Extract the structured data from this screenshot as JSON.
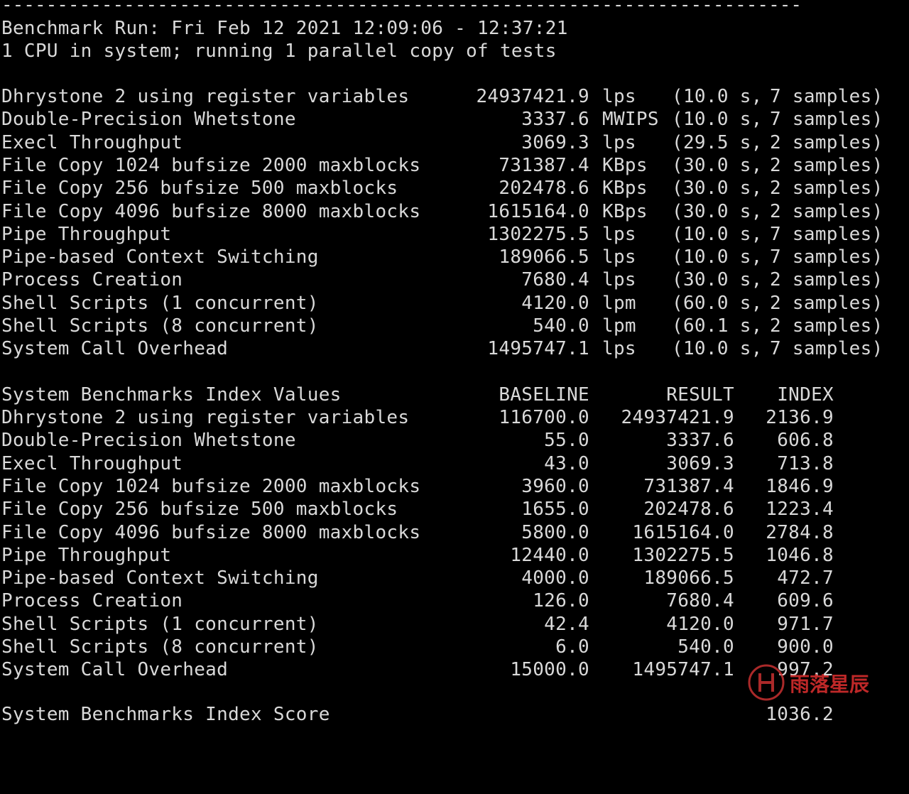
{
  "rule": "------------------------------------------------------------------------",
  "header": {
    "run": "Benchmark Run: Fri Feb 12 2021 12:09:06 - 12:37:21",
    "cpus": "1 CPU in system; running 1 parallel copy of tests"
  },
  "results": [
    {
      "name": "Dhrystone 2 using register variables",
      "value": "24937421.9",
      "unit": "lps",
      "time": "(10.0 s,",
      "samples": "7 samples)"
    },
    {
      "name": "Double-Precision Whetstone",
      "value": "3337.6",
      "unit": "MWIPS",
      "time": "(10.0 s,",
      "samples": "7 samples)"
    },
    {
      "name": "Execl Throughput",
      "value": "3069.3",
      "unit": "lps",
      "time": "(29.5 s,",
      "samples": "2 samples)"
    },
    {
      "name": "File Copy 1024 bufsize 2000 maxblocks",
      "value": "731387.4",
      "unit": "KBps",
      "time": "(30.0 s,",
      "samples": "2 samples)"
    },
    {
      "name": "File Copy 256 bufsize 500 maxblocks",
      "value": "202478.6",
      "unit": "KBps",
      "time": "(30.0 s,",
      "samples": "2 samples)"
    },
    {
      "name": "File Copy 4096 bufsize 8000 maxblocks",
      "value": "1615164.0",
      "unit": "KBps",
      "time": "(30.0 s,",
      "samples": "2 samples)"
    },
    {
      "name": "Pipe Throughput",
      "value": "1302275.5",
      "unit": "lps",
      "time": "(10.0 s,",
      "samples": "7 samples)"
    },
    {
      "name": "Pipe-based Context Switching",
      "value": "189066.5",
      "unit": "lps",
      "time": "(10.0 s,",
      "samples": "7 samples)"
    },
    {
      "name": "Process Creation",
      "value": "7680.4",
      "unit": "lps",
      "time": "(30.0 s,",
      "samples": "2 samples)"
    },
    {
      "name": "Shell Scripts (1 concurrent)",
      "value": "4120.0",
      "unit": "lpm",
      "time": "(60.0 s,",
      "samples": "2 samples)"
    },
    {
      "name": "Shell Scripts (8 concurrent)",
      "value": "540.0",
      "unit": "lpm",
      "time": "(60.1 s,",
      "samples": "2 samples)"
    },
    {
      "name": "System Call Overhead",
      "value": "1495747.1",
      "unit": "lps",
      "time": "(10.0 s,",
      "samples": "7 samples)"
    }
  ],
  "index": {
    "title": "System Benchmarks Index Values",
    "col_baseline": "BASELINE",
    "col_result": "RESULT",
    "col_index": "INDEX",
    "rows": [
      {
        "name": "Dhrystone 2 using register variables",
        "baseline": "116700.0",
        "result": "24937421.9",
        "index": "2136.9"
      },
      {
        "name": "Double-Precision Whetstone",
        "baseline": "55.0",
        "result": "3337.6",
        "index": "606.8"
      },
      {
        "name": "Execl Throughput",
        "baseline": "43.0",
        "result": "3069.3",
        "index": "713.8"
      },
      {
        "name": "File Copy 1024 bufsize 2000 maxblocks",
        "baseline": "3960.0",
        "result": "731387.4",
        "index": "1846.9"
      },
      {
        "name": "File Copy 256 bufsize 500 maxblocks",
        "baseline": "1655.0",
        "result": "202478.6",
        "index": "1223.4"
      },
      {
        "name": "File Copy 4096 bufsize 8000 maxblocks",
        "baseline": "5800.0",
        "result": "1615164.0",
        "index": "2784.8"
      },
      {
        "name": "Pipe Throughput",
        "baseline": "12440.0",
        "result": "1302275.5",
        "index": "1046.8"
      },
      {
        "name": "Pipe-based Context Switching",
        "baseline": "4000.0",
        "result": "189066.5",
        "index": "472.7"
      },
      {
        "name": "Process Creation",
        "baseline": "126.0",
        "result": "7680.4",
        "index": "609.6"
      },
      {
        "name": "Shell Scripts (1 concurrent)",
        "baseline": "42.4",
        "result": "4120.0",
        "index": "971.7"
      },
      {
        "name": "Shell Scripts (8 concurrent)",
        "baseline": "6.0",
        "result": "540.0",
        "index": "900.0"
      },
      {
        "name": "System Call Overhead",
        "baseline": "15000.0",
        "result": "1495747.1",
        "index": "997.2"
      }
    ],
    "rule": "========",
    "score_label": "System Benchmarks Index Score",
    "score_value": "1036.2"
  },
  "watermark": {
    "text": "雨落星辰",
    "color": "#e03030"
  }
}
